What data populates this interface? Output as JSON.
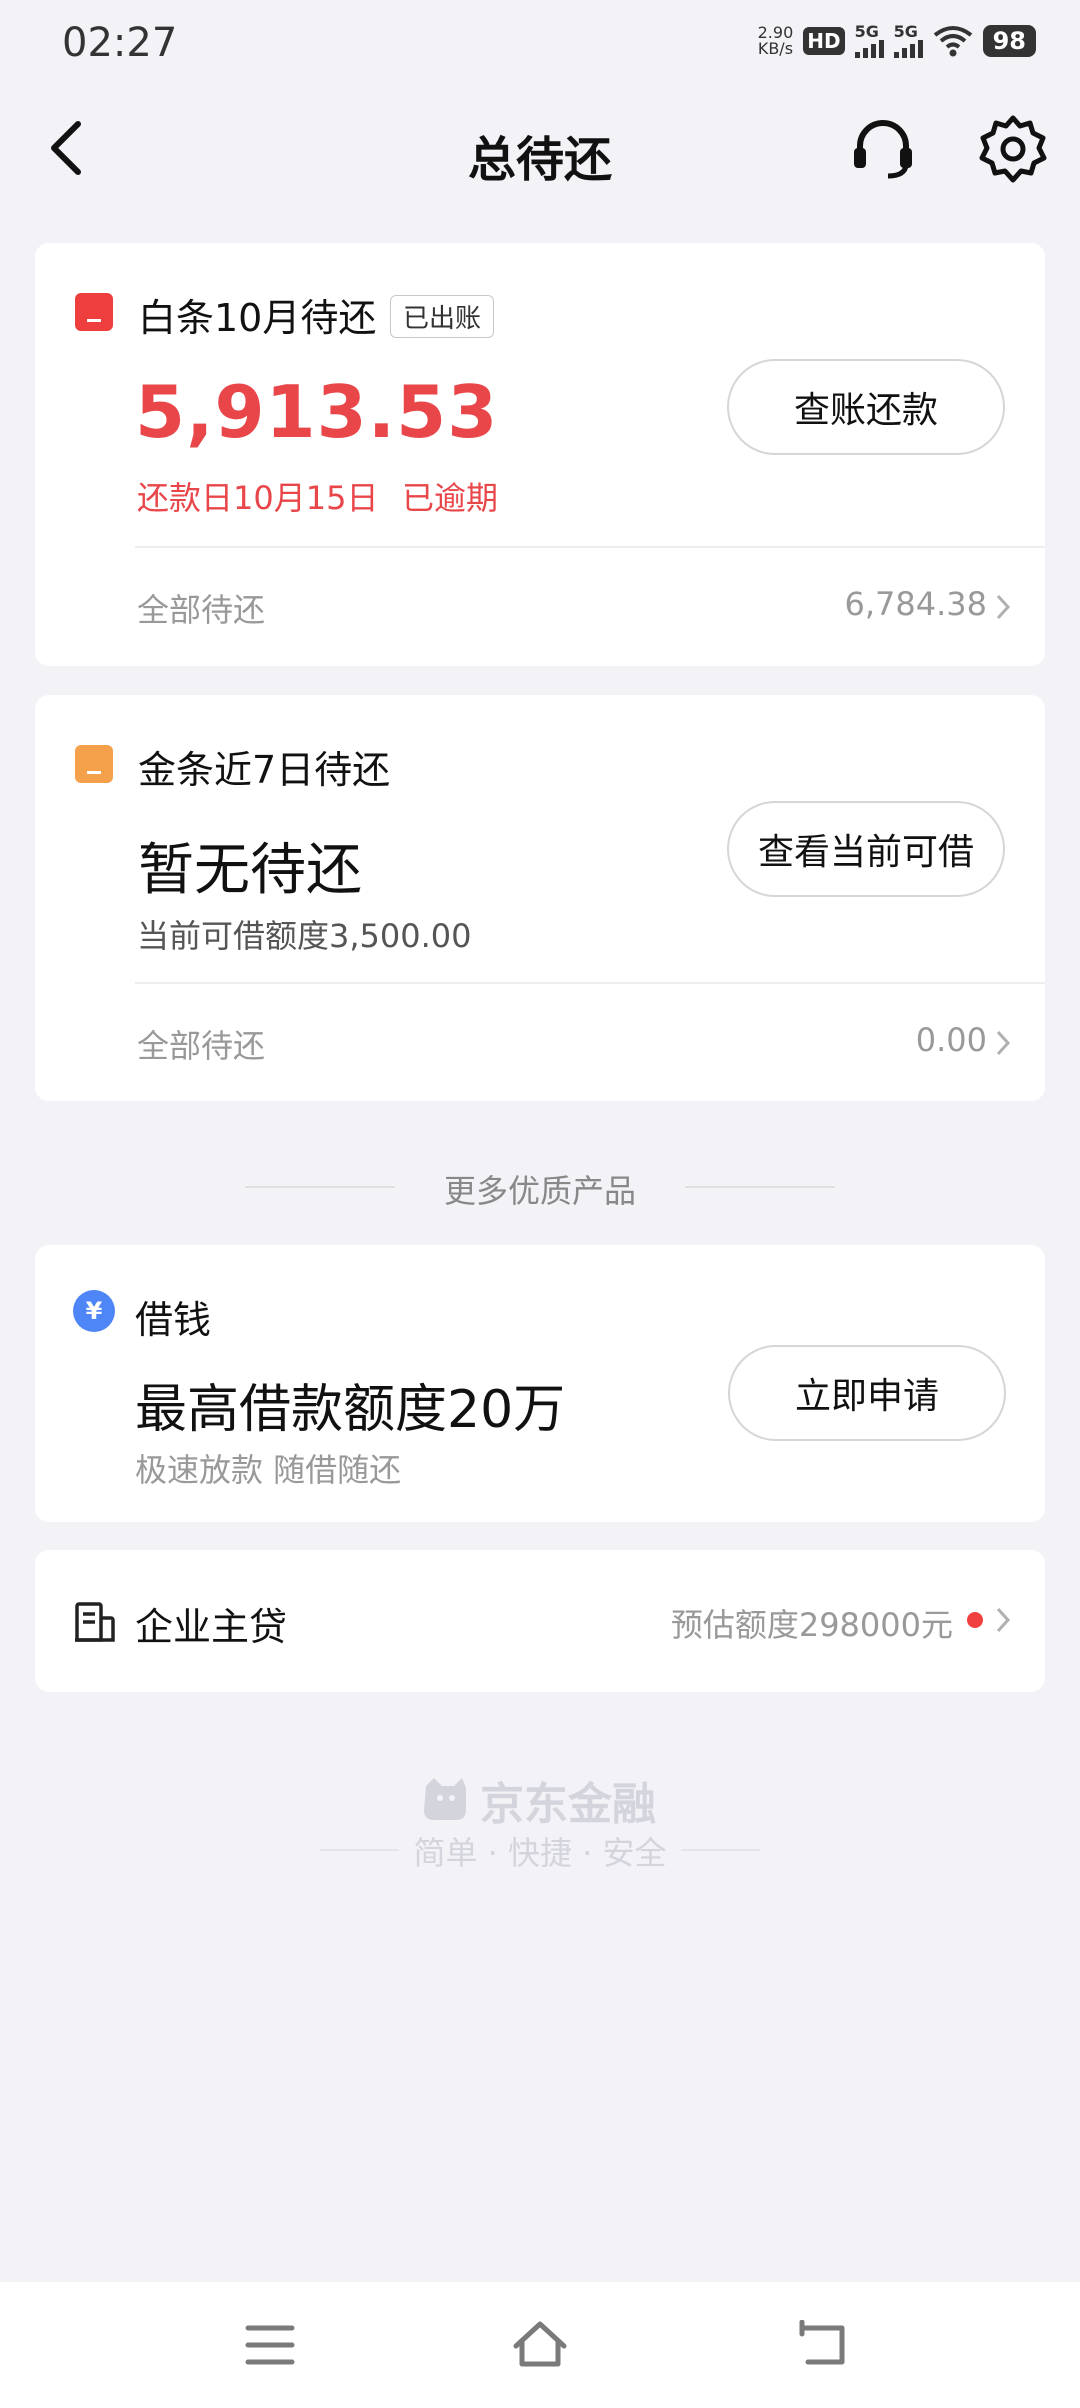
{
  "status_bar": {
    "time": "02:27",
    "net_speed_value": "2.90",
    "net_speed_unit": "KB/s",
    "hd_label": "HD",
    "sim1_label": "5G",
    "sim2_label": "5G",
    "battery": "98"
  },
  "header": {
    "title": "总待还",
    "icons": [
      "back-icon",
      "headset-icon",
      "gear-icon"
    ]
  },
  "baitiao": {
    "label": "白条10月待还",
    "badge": "已出账",
    "amount": "5,913.53",
    "due_date": "还款日10月15日",
    "status": "已逾期",
    "button": "查账还款",
    "total_label": "全部待还",
    "total_value": "6,784.38"
  },
  "jintiao": {
    "label": "金条近7日待还",
    "headline": "暂无待还",
    "sub": "当前可借额度3,500.00",
    "button": "查看当前可借",
    "total_label": "全部待还",
    "total_value": "0.00"
  },
  "more_products": {
    "separator": "更多优质产品"
  },
  "borrow": {
    "label": "借钱",
    "icon_symbol": "¥",
    "headline": "最高借款额度20万",
    "sub": "极速放款 随借随还",
    "button": "立即申请"
  },
  "enterprise": {
    "label": "企业主贷",
    "estimate": "预估额度298000元"
  },
  "footer": {
    "brand": "京东金融",
    "slogan": "简单 · 快捷 · 安全"
  },
  "colors": {
    "accent_red": "#e9464a",
    "orange": "#f5a04b",
    "blue": "#4f86f7",
    "background": "#f2f2f7"
  }
}
